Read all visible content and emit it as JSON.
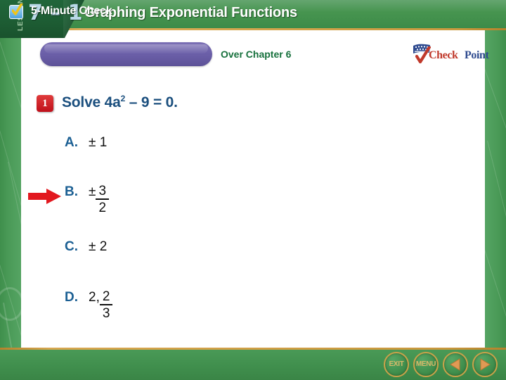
{
  "header": {
    "lesson_word": "LESSON",
    "lesson_number": "7 – 1",
    "title": "Graphing Exponential Functions"
  },
  "banner": {
    "check_label": "5-Minute Check",
    "check_icon": "checkbox-check-icon",
    "over_label": "Over Chapter 6"
  },
  "logo": {
    "check_word": "Check",
    "point_word": "Point",
    "flag_icon": "flag-icon",
    "tick_icon": "checkmark-icon",
    "colors": {
      "check": "#c0392b",
      "point": "#2e4a8f"
    }
  },
  "question": {
    "number": "1",
    "prompt_before": "Solve 4a",
    "exponent": "2",
    "prompt_after": " – 9 = 0."
  },
  "choices": [
    {
      "letter": "A.",
      "value": "± 1",
      "type": "plain",
      "selected": false
    },
    {
      "letter": "B.",
      "value": "±",
      "type": "fraction",
      "numerator": "3",
      "denominator": "2",
      "selected": true
    },
    {
      "letter": "C.",
      "value": "± 2",
      "type": "plain",
      "selected": false
    },
    {
      "letter": "D.",
      "value": "2,",
      "type": "fraction",
      "numerator": "2",
      "denominator": "3",
      "selected": false
    }
  ],
  "answer_arrow": {
    "points_to": "B.",
    "color": "#e2181f"
  },
  "toolbar": {
    "exit_label": "EXIT",
    "menu_label": "MENU",
    "prev_icon": "triangle-left-icon",
    "next_icon": "triangle-right-icon"
  },
  "colors": {
    "header_green": "#46944f",
    "dark_green": "#1d5c33",
    "gold_rule": "#c99a3f",
    "banner_purple": "#6b5fa8",
    "question_blue": "#1b4f7e",
    "choice_letter_blue": "#1b5f93",
    "over_green": "#16703c",
    "badge_red": "#c0101b"
  }
}
